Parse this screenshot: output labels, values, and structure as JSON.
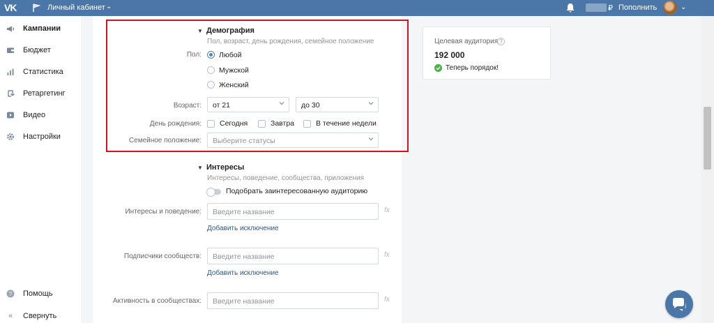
{
  "topbar": {
    "logo": "VK",
    "title": "Личный кабинет",
    "currency": "₽",
    "topup": "Пополнить",
    "icons": {
      "flag": "flag-icon",
      "bell": "bell-icon",
      "caret": "chevron-down-icon"
    }
  },
  "sidebar": {
    "items": [
      {
        "label": "Кампании",
        "icon": "megaphone-icon",
        "active": true
      },
      {
        "label": "Бюджет",
        "icon": "wallet-icon",
        "active": false
      },
      {
        "label": "Статистика",
        "icon": "bar-chart-icon",
        "active": false
      },
      {
        "label": "Ретаргетинг",
        "icon": "retarget-icon",
        "active": false
      },
      {
        "label": "Видео",
        "icon": "video-icon",
        "active": false
      },
      {
        "label": "Настройки",
        "icon": "gear-icon",
        "active": false
      }
    ],
    "help": "Помощь",
    "collapse": "Свернуть"
  },
  "demography": {
    "title": "Демография",
    "subtitle": "Пол, возраст, день рождения, семейное положение",
    "gender_label": "Пол:",
    "gender_options": [
      "Любой",
      "Мужской",
      "Женский"
    ],
    "gender_selected": "Любой",
    "age_label": "Возраст:",
    "age_from": "от 21",
    "age_to": "до 30",
    "birthday_label": "День рождения:",
    "birthday_options": [
      "Сегодня",
      "Завтра",
      "В течение недели"
    ],
    "marital_label": "Семейное положение:",
    "marital_placeholder": "Выберите статусы"
  },
  "interests": {
    "title": "Интересы",
    "subtitle": "Интересы, поведение, сообщества, приложения",
    "toggle_label": "Подобрать заинтересованную аудиторию",
    "fields": [
      {
        "label": "Интересы и поведение:",
        "placeholder": "Введите название",
        "exclude": "Добавить исключение"
      },
      {
        "label": "Подписчики сообществ:",
        "placeholder": "Введите название",
        "exclude": "Добавить исключение"
      },
      {
        "label": "Активность в сообществах:",
        "placeholder": "Введите название"
      }
    ],
    "fx": "fx"
  },
  "audience_card": {
    "title": "Целевая аудитория",
    "help": "?",
    "count": "192 000",
    "status": "Теперь порядок!"
  },
  "colors": {
    "brand": "#4a76a8",
    "highlight": "#d0121c",
    "success": "#4bb34b",
    "link": "#2a5885"
  }
}
